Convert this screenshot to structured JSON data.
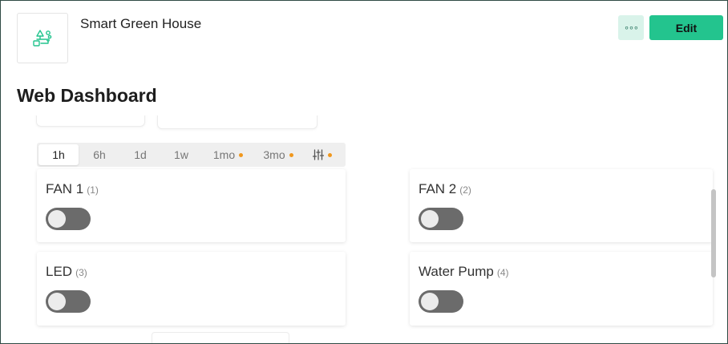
{
  "header": {
    "device_name": "Smart Green House",
    "more_label": "∘∘∘",
    "edit_label": "Edit"
  },
  "page": {
    "title": "Web Dashboard"
  },
  "time_tabs": [
    {
      "label": "1h",
      "active": true,
      "dot": false
    },
    {
      "label": "6h",
      "active": false,
      "dot": false
    },
    {
      "label": "1d",
      "active": false,
      "dot": false
    },
    {
      "label": "1w",
      "active": false,
      "dot": false
    },
    {
      "label": "1mo",
      "active": false,
      "dot": true
    },
    {
      "label": "3mo",
      "active": false,
      "dot": true
    },
    {
      "label": "custom-range-icon",
      "active": false,
      "dot": true
    }
  ],
  "widgets": [
    {
      "title": "FAN 1",
      "pin": "(1)",
      "state": "off"
    },
    {
      "title": "FAN 2",
      "pin": "(2)",
      "state": "off"
    },
    {
      "title": "LED",
      "pin": "(3)",
      "state": "off"
    },
    {
      "title": "Water Pump",
      "pin": "(4)",
      "state": "off"
    }
  ],
  "colors": {
    "accent": "#23c48e",
    "toggle_off": "#6b6b6b",
    "dot": "#f0971d"
  }
}
